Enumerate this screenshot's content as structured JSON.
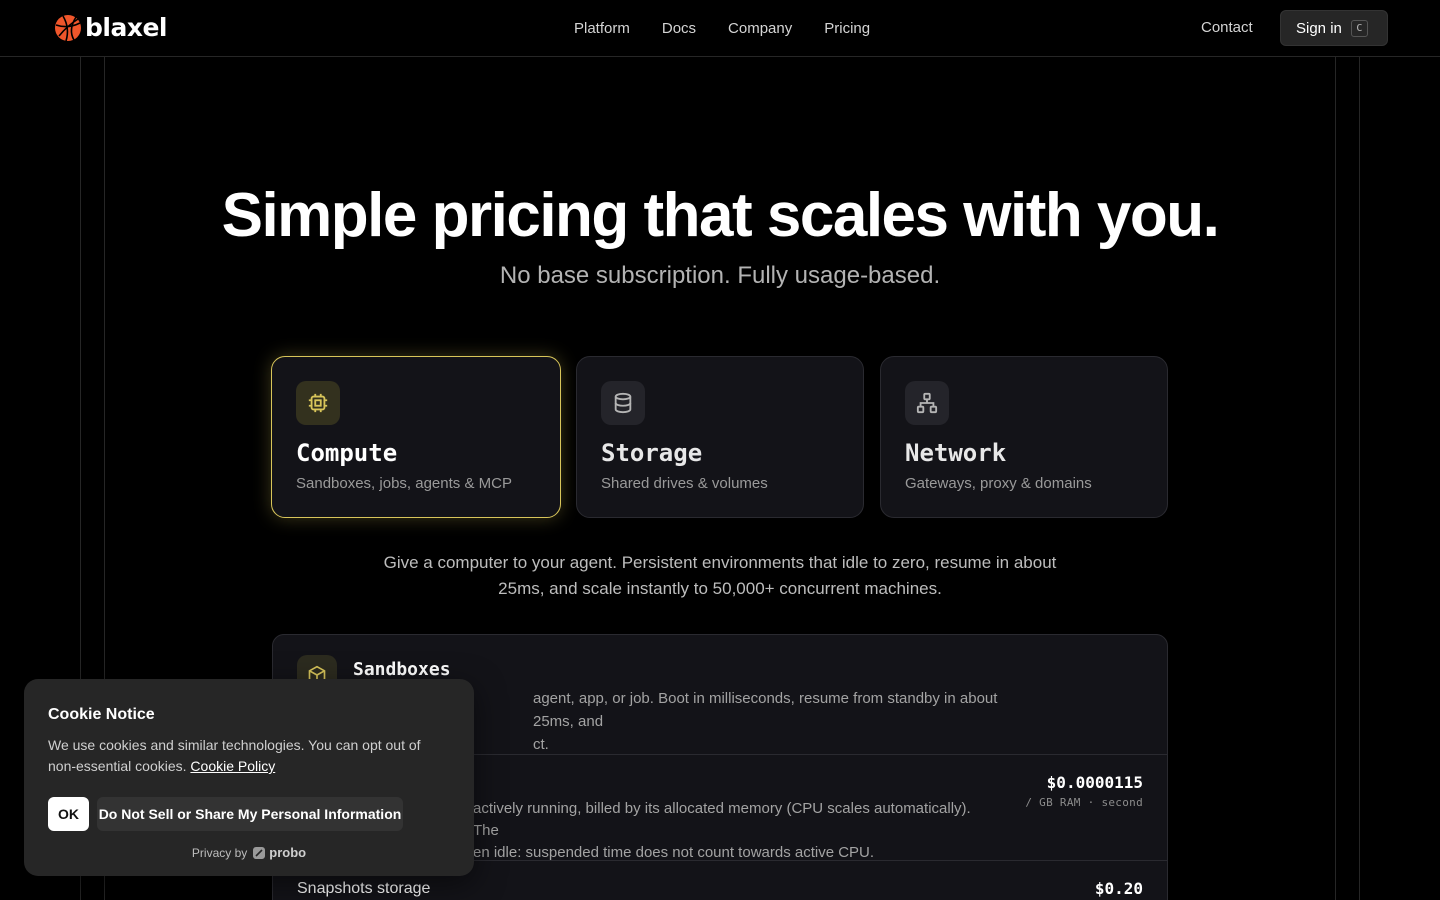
{
  "header": {
    "logo_text": "blaxel",
    "nav": [
      {
        "label": "Platform"
      },
      {
        "label": "Docs"
      },
      {
        "label": "Company"
      },
      {
        "label": "Pricing"
      }
    ],
    "contact_label": "Contact",
    "signin_label": "Sign in",
    "signin_kbd": "C"
  },
  "hero": {
    "title": "Simple pricing that scales with you.",
    "subtitle": "No base subscription. Fully usage-based."
  },
  "categories": [
    {
      "title": "Compute",
      "desc": "Sandboxes, jobs, agents & MCP",
      "icon": "cpu-icon",
      "active": true
    },
    {
      "title": "Storage",
      "desc": "Shared drives & volumes",
      "icon": "database-icon",
      "active": false
    },
    {
      "title": "Network",
      "desc": "Gateways, proxy & domains",
      "icon": "network-icon",
      "active": false
    }
  ],
  "intro": "Give a computer to your agent. Persistent environments that idle to zero, resume in about 25ms, and scale instantly to 50,000+ concurrent machines.",
  "sandboxes": {
    "title": "Sandboxes",
    "desc": "agent, app, or job. Boot in milliseconds, resume from standby in about 25ms, and",
    "desc_line2": "ct.",
    "rows": [
      {
        "desc": "actively running, billed by its allocated memory (CPU scales automatically). The",
        "desc_line2": "en idle: suspended time does not count towards active CPU.",
        "price": "$0.0000115",
        "unit": "/ GB RAM · second"
      },
      {
        "title": "Snapshots storage",
        "price": "$0.20"
      }
    ]
  },
  "cookie": {
    "title": "Cookie Notice",
    "body": "We use cookies and similar technologies. You can opt out of non-essential cookies.",
    "link": "Cookie Policy",
    "ok_label": "OK",
    "dns_label": "Do Not Sell or Share My Personal Information",
    "privacy_by": "Privacy by",
    "brand": "probo"
  },
  "colors": {
    "accent": "#d8c55a",
    "background": "#000000",
    "card": "#131318"
  }
}
